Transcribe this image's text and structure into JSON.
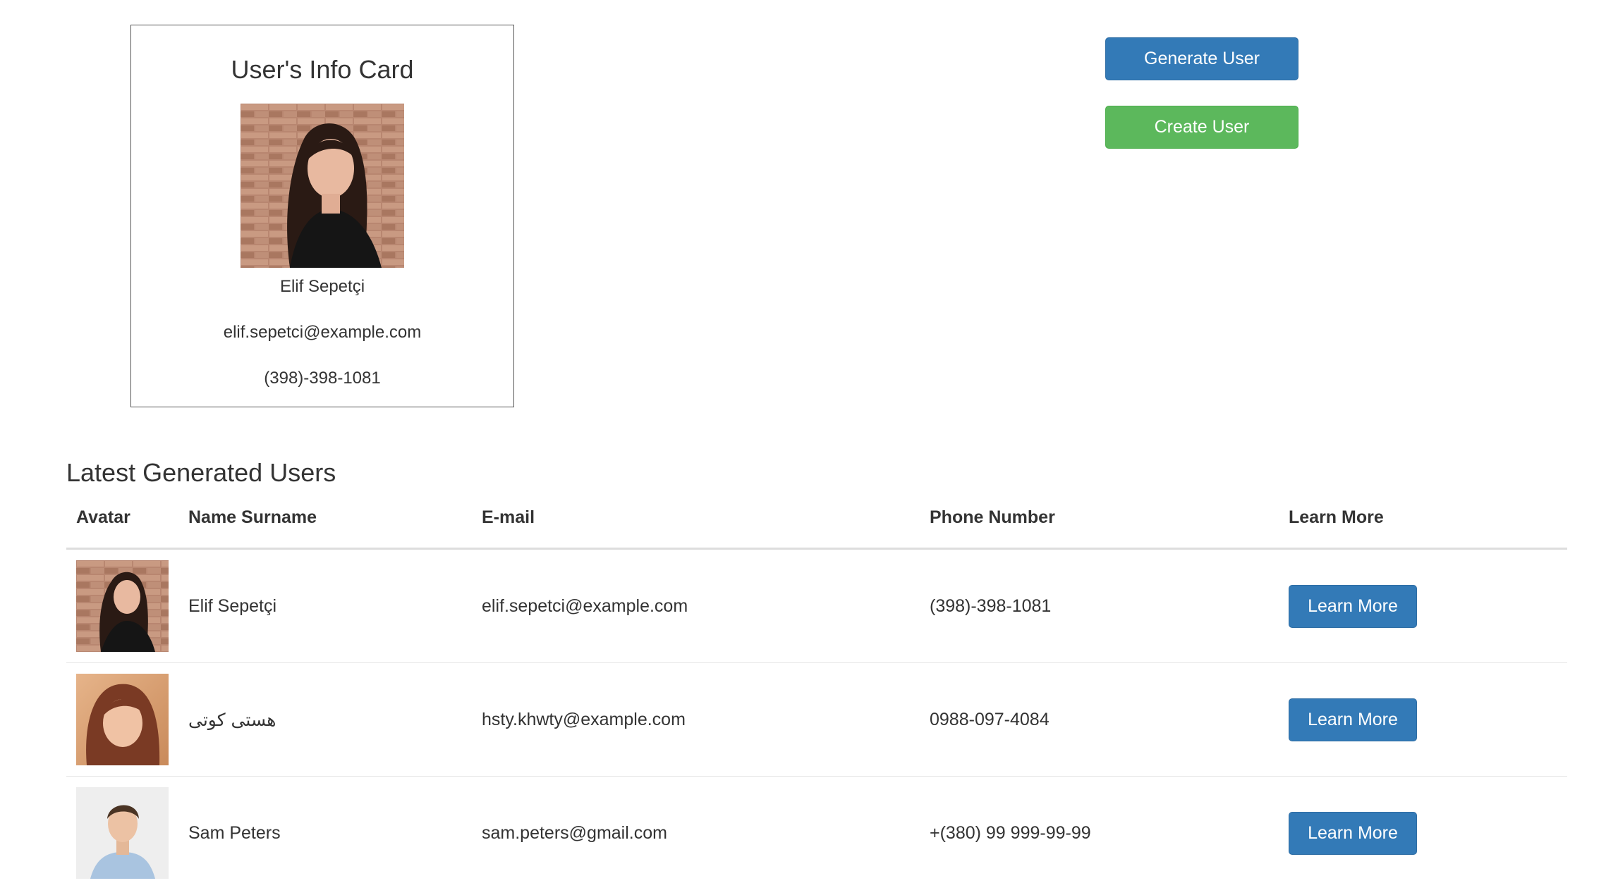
{
  "info_card": {
    "title": "User's Info Card",
    "name": "Elif Sepetçi",
    "email": "elif.sepetci@example.com",
    "phone": "(398)-398-1081"
  },
  "actions": {
    "generate_label": "Generate User",
    "create_label": "Create User"
  },
  "latest": {
    "title": "Latest Generated Users",
    "columns": [
      "Avatar",
      "Name Surname",
      "E-mail",
      "Phone Number",
      "Learn More"
    ],
    "rows": [
      {
        "name": "Elif Sepetçi",
        "email": "elif.sepetci@example.com",
        "phone": "(398)-398-1081",
        "button": "Learn More"
      },
      {
        "name": "هستی کوتی",
        "email": "hsty.khwty@example.com",
        "phone": "0988-097-4084",
        "button": "Learn More"
      },
      {
        "name": "Sam Peters",
        "email": "sam.peters@gmail.com",
        "phone": "+(380) 99 999-99-99",
        "button": "Learn More"
      }
    ]
  },
  "colors": {
    "primary": "#337ab7",
    "success": "#5cb85c"
  }
}
